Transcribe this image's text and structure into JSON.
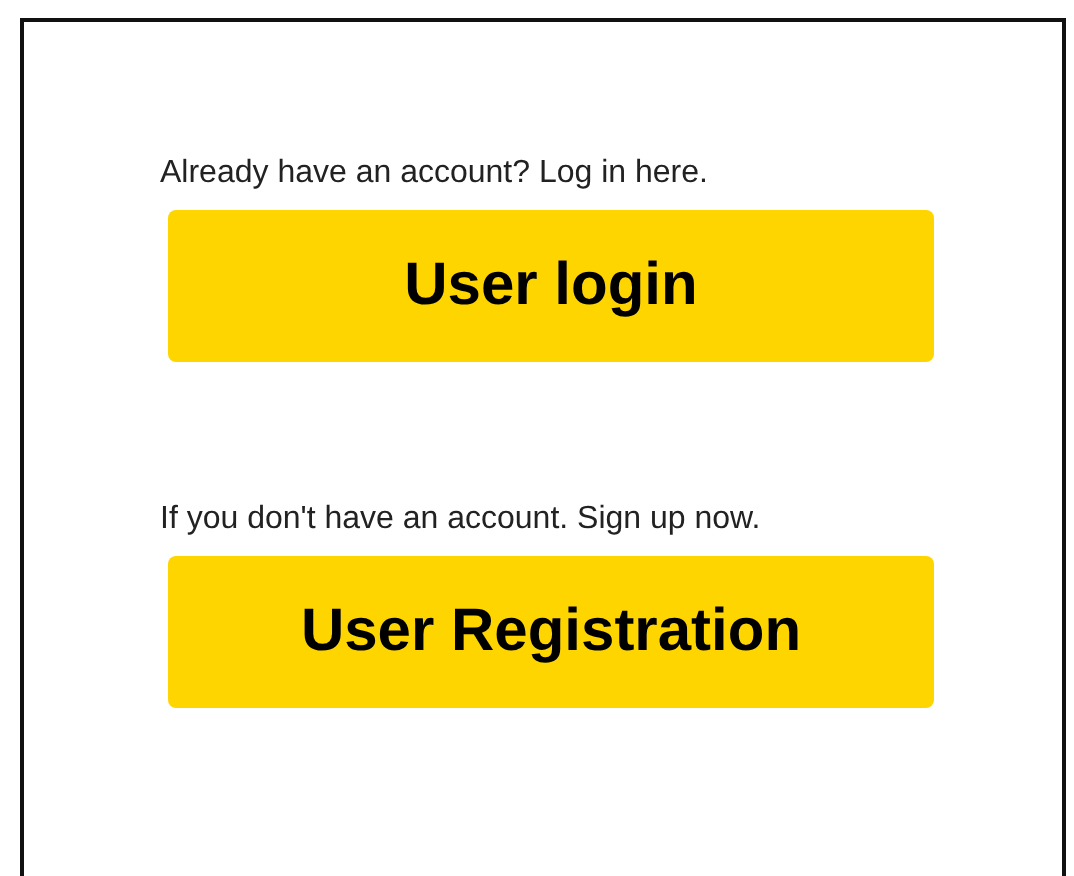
{
  "sections": [
    {
      "prompt": "Already have an account? Log in here.",
      "button": "User login"
    },
    {
      "prompt": "If you don't have an account. Sign up now.",
      "button": "User Registration"
    }
  ]
}
